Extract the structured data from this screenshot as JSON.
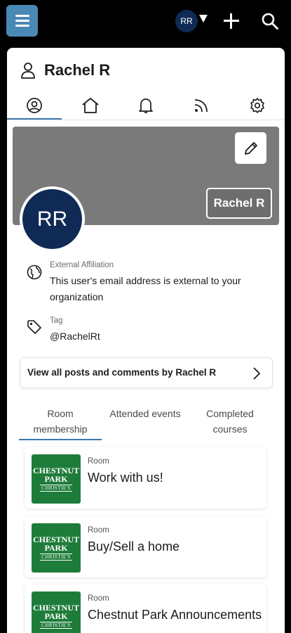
{
  "topbar": {
    "avatar_initials": "RR"
  },
  "profile": {
    "name": "Rachel R",
    "cover_name_badge": "Rachel R",
    "avatar_initials": "RR"
  },
  "tabs": [
    {
      "icon": "profile-icon",
      "active": true
    },
    {
      "icon": "home-icon",
      "active": false
    },
    {
      "icon": "bell-icon",
      "active": false
    },
    {
      "icon": "feed-icon",
      "active": false
    },
    {
      "icon": "gear-icon",
      "active": false
    }
  ],
  "info": {
    "affiliation_label": "External Affiliation",
    "affiliation_value": "This user's email address is external to your organization",
    "tag_label": "Tag",
    "tag_value": "@RachelRt"
  },
  "view_posts_label": "View all posts and comments by Rachel R",
  "subtabs": {
    "room_membership": "Room membership",
    "attended_events": "Attended events",
    "completed_courses": "Completed courses"
  },
  "rooms": [
    {
      "type": "Room",
      "name": "Work with us!"
    },
    {
      "type": "Room",
      "name": "Buy/Sell a home"
    },
    {
      "type": "Room",
      "name": "Chestnut Park Announcements"
    }
  ],
  "room_logo": {
    "line1": "CHESTNUT",
    "line2": "PARK",
    "line3": "CHRISTIE'S"
  },
  "colors": {
    "topbar": "#000000",
    "menu_button": "#4a88b5",
    "avatar": "#0f2a55",
    "cover": "#7a7a7a",
    "accent": "#3a7ab0",
    "room_logo": "#1e7c3a"
  }
}
